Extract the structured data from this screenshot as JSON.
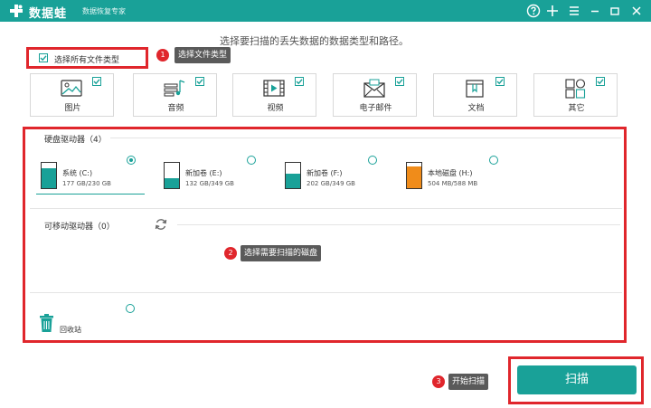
{
  "app": {
    "name": "数据蛙",
    "tagline": "数据恢复专家",
    "brand_color": "#19a198",
    "highlight_color": "#e0262c"
  },
  "window_controls": [
    "help-icon",
    "plus-icon",
    "menu-icon",
    "minimize-icon",
    "maximize-icon",
    "close-icon"
  ],
  "header": {
    "subtitle": "选择要扫描的丢失数据的数据类型和路径。"
  },
  "select_all": {
    "label": "选择所有文件类型",
    "checked": true
  },
  "steps": [
    {
      "number": "1",
      "tip": "选择文件类型"
    },
    {
      "number": "2",
      "tip": "选择需要扫描的磁盘"
    },
    {
      "number": "3",
      "tip": "开始扫描"
    }
  ],
  "file_types": [
    {
      "label": "图片",
      "icon": "image-icon",
      "checked": true
    },
    {
      "label": "音频",
      "icon": "audio-icon",
      "checked": true
    },
    {
      "label": "视频",
      "icon": "video-icon",
      "checked": true
    },
    {
      "label": "电子邮件",
      "icon": "email-icon",
      "checked": true
    },
    {
      "label": "文档",
      "icon": "document-icon",
      "checked": true
    },
    {
      "label": "其它",
      "icon": "other-icon",
      "checked": true
    }
  ],
  "hard_drives": {
    "title": "硬盘驱动器（4）",
    "items": [
      {
        "name": "系统 (C:)",
        "size": "177 GB/230 GB",
        "used_fraction": 0.77,
        "color": "#19a198",
        "selected": true
      },
      {
        "name": "新加卷 (E:)",
        "size": "132 GB/349 GB",
        "used_fraction": 0.38,
        "color": "#19a198",
        "selected": false
      },
      {
        "name": "新加卷 (F:)",
        "size": "202 GB/349 GB",
        "used_fraction": 0.58,
        "color": "#19a198",
        "selected": false
      },
      {
        "name": "本地磁盘 (H:)",
        "size": "504 MB/588 MB",
        "used_fraction": 0.86,
        "color": "#f08c1a",
        "selected": false
      }
    ]
  },
  "removable": {
    "title": "可移动驱动器（0）"
  },
  "recycle_bin": {
    "label": "回收站"
  },
  "scan_button": {
    "label": "扫描"
  }
}
